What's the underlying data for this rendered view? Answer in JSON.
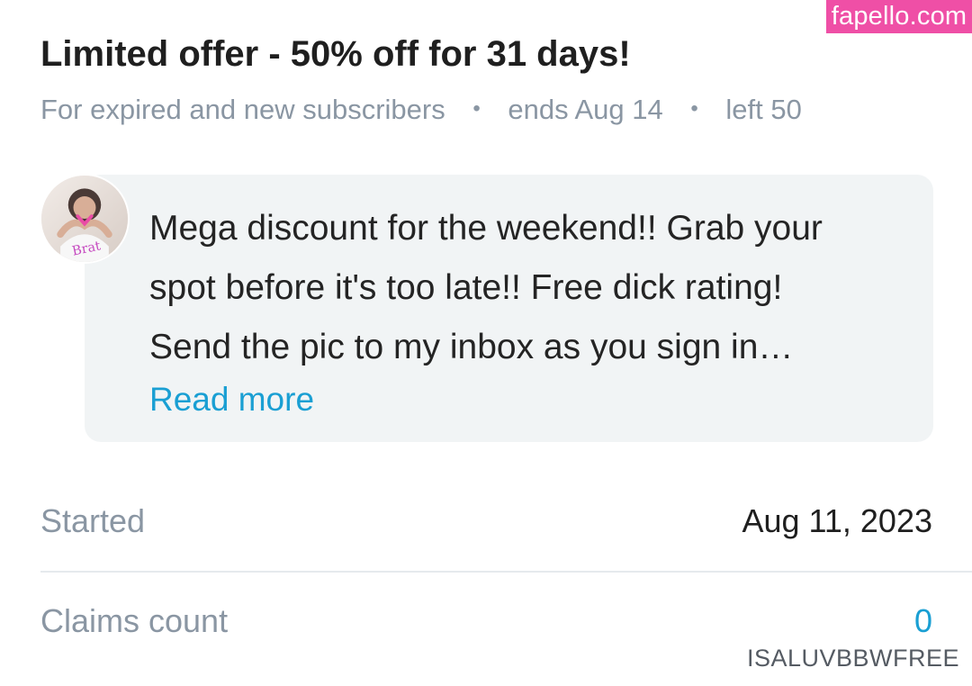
{
  "watermark": "fapello.com",
  "offer": {
    "title": "Limited offer - 50% off for 31 days!",
    "meta": [
      "For expired and new subscribers",
      "ends Aug 14",
      "left 50"
    ]
  },
  "message": {
    "lines": [
      "Mega discount for the weekend!! Grab your",
      "spot before it's too late!! Free dick rating!",
      "Send the pic to my inbox as you sign in…"
    ],
    "read_more": "Read more",
    "avatar_text": "Brat"
  },
  "details": {
    "started_label": "Started",
    "started_value": "Aug 11, 2023",
    "claims_label": "Claims count",
    "claims_value": "0"
  },
  "footer_watermark": "ISALUVBBWFREE",
  "colors": {
    "accent": "#1a9fd3",
    "muted": "#8a96a3",
    "bubble": "#f1f4f5",
    "watermark": "#ef4fa6"
  }
}
